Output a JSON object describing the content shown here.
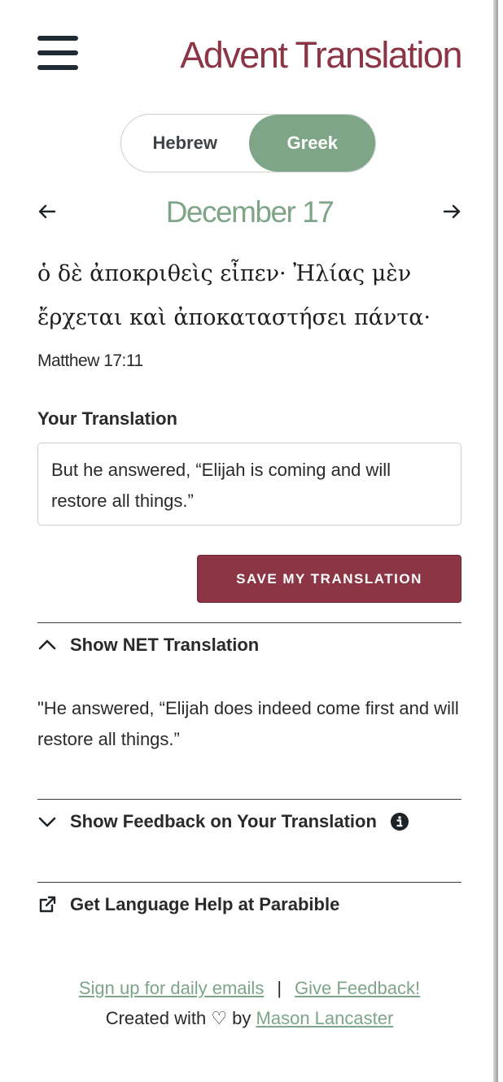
{
  "header": {
    "title": "Advent Translation"
  },
  "language_toggle": {
    "options": [
      "Hebrew",
      "Greek"
    ],
    "selected": "Greek"
  },
  "date_nav": {
    "date": "December 17"
  },
  "verse": {
    "greek_line1": "ὁ δὲ ἀποκριθεὶς εἶπεν· Ἠλίας μὲν",
    "greek_line2": "ἔρχεται καὶ ἀποκαταστήσει πάντα·",
    "reference": "Matthew 17:11"
  },
  "translation": {
    "label": "Your Translation",
    "value": "But he answered, “Elijah is coming and will restore all things.”",
    "save_label": "SAVE MY TRANSLATION"
  },
  "net_section": {
    "label": "Show NET Translation",
    "expanded": true,
    "text": "\"He answered, “Elijah does indeed come first and will restore all things.”"
  },
  "feedback_section": {
    "label": "Show Feedback on Your Translation",
    "expanded": false
  },
  "help_link": {
    "label": "Get Language Help at Parabible"
  },
  "footer": {
    "signup_link": "Sign up for daily emails",
    "separator": "|",
    "feedback_link": "Give Feedback!",
    "created_prefix": "Created with ♡ by",
    "author_link": "Mason Lancaster"
  },
  "colors": {
    "brand": "#8b3545",
    "accent": "#7ea587"
  }
}
